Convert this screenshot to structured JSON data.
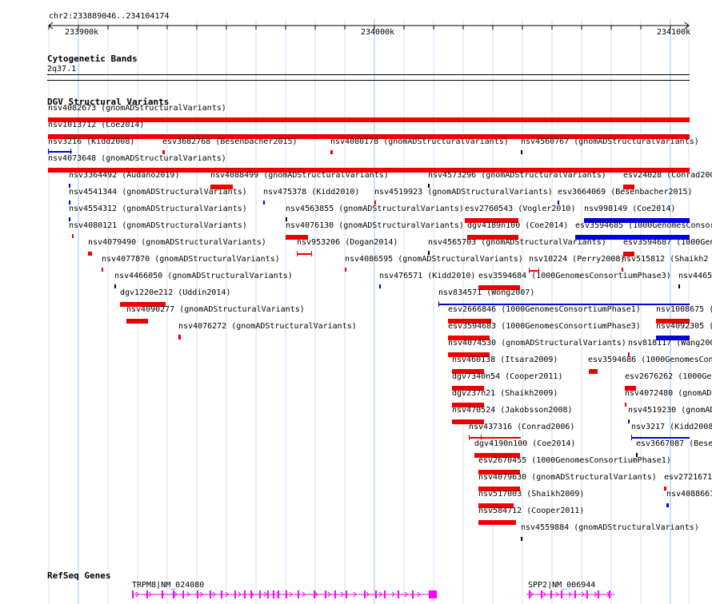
{
  "header": {
    "locus": "chr2:233889046..234104174"
  },
  "ruler": {
    "ticks": [
      "233900k",
      "234000k",
      "234100k"
    ]
  },
  "cytoband": {
    "title": "Cytogenetic Bands",
    "band": "2q37.1"
  },
  "dgv": {
    "title": "DGV Structural Variants",
    "features": [
      {
        "id": "nsv4082673 (gnomADStructuralVariants)",
        "color": "#ee0000"
      },
      {
        "id": "nsv1013712 (Coe2014)",
        "color": "#ee0000"
      },
      {
        "id": "nsv3216 (Kidd2008)",
        "color": "#0000dd"
      },
      {
        "id": "esv3682768 (Besenbacher2015)",
        "color": "#ee0000"
      },
      {
        "id": "nsv4080178 (gnomADStructuralVariants)",
        "color": "#ee0000"
      },
      {
        "id": "nsv4560767 (gnomADStructuralVariants)",
        "color": "#000000"
      },
      {
        "id": "nsv4073648 (gnomADStructuralVariants)",
        "color": "#ee0000"
      },
      {
        "id": "nsv3364492 (Audano2019)",
        "color": "#0000dd"
      },
      {
        "id": "nsv4088499 (gnomADStructuralVariants)",
        "color": "#ee0000"
      },
      {
        "id": "nsv4573296 (gnomADStructuralVariants)",
        "color": "#000000"
      },
      {
        "id": "esv24028 (Conrad200",
        "color": "#ee0000"
      },
      {
        "id": "nsv4541344 (gnomADStructuralVariants)",
        "color": "#0000dd"
      },
      {
        "id": "nsv475378 (Kidd2010)",
        "color": "#0000dd"
      },
      {
        "id": "nsv4519923 (gnomADStructuralVariants)",
        "color": "#ee0000"
      },
      {
        "id": "esv3664069 (Besenbacher2015)",
        "color": "#0000dd"
      },
      {
        "id": "nsv4554312 (gnomADStructuralVariants)",
        "color": "#0000dd"
      },
      {
        "id": "nsv4563855 (gnomADStructuralVariants)",
        "color": "#000000"
      },
      {
        "id": "esv2760543 (Vogler2010)",
        "color": "#ee0000"
      },
      {
        "id": "nsv998149 (Coe2014)",
        "color": "#0000dd"
      },
      {
        "id": "nsv4080121 (gnomADStructuralVariants)",
        "color": "#ee0000"
      },
      {
        "id": "nsv4076130 (gnomADStructuralVariants)",
        "color": "#ee0000"
      },
      {
        "id": "dgv4189n100 (Coe2014)",
        "color": "#ee0000"
      },
      {
        "id": "esv3594685 (1000GenomesConsor",
        "color": "#0000dd"
      },
      {
        "id": "nsv4079490 (gnomADStructuralVariants)",
        "color": "#ee0000"
      },
      {
        "id": "nsv953206 (Dogan2014)",
        "color": "#ee0000"
      },
      {
        "id": "nsv4565703 (gnomADStructuralVariants)",
        "color": "#000000"
      },
      {
        "id": "esv3594687 (1000Gen",
        "color": "#ee0000"
      },
      {
        "id": "nsv4077870 (gnomADStructuralVariants)",
        "color": "#ee0000"
      },
      {
        "id": "nsv4086595 (gnomADStructuralVariants)",
        "color": "#ee0000"
      },
      {
        "id": "nsv10224 (Perry2008)",
        "color": "#ee0000"
      },
      {
        "id": "nsv515812 (Shaikh2",
        "color": "#ee0000"
      },
      {
        "id": "nsv4466050 (gnomADStructuralVariants)",
        "color": "#000000"
      },
      {
        "id": "nsv476571 (Kidd2010)",
        "color": "#0000dd"
      },
      {
        "id": "esv3594684 (1000GenomesConsortiumPhase3)",
        "color": "#ee0000"
      },
      {
        "id": "nsv4465",
        "color": "#000000"
      },
      {
        "id": "dgv1220e212 (Uddin2014)",
        "color": "#ee0000"
      },
      {
        "id": "nsv834571 (Wong2007)",
        "color": "#0000dd"
      },
      {
        "id": "nsv4090277 (gnomADStructuralVariants)",
        "color": "#ee0000"
      },
      {
        "id": "esv2666846 (1000GenomesConsortiumPhase1)",
        "color": "#ee0000"
      },
      {
        "id": "nsv1008675 (Coe",
        "color": "#ee0000"
      },
      {
        "id": "nsv4076272 (gnomADStructuralVariants)",
        "color": "#ee0000"
      },
      {
        "id": "esv3594683 (1000GenomesConsortiumPhase3)",
        "color": "#ee0000"
      },
      {
        "id": "nsv4092305 (gno",
        "color": "#0000dd"
      },
      {
        "id": "nsv4074530 (gnomADStructuralVariants)",
        "color": "#ee0000"
      },
      {
        "id": "nsv818117 (Wang200",
        "color": "#ee0000"
      },
      {
        "id": "nsv460138 (Itsara2009)",
        "color": "#ee0000"
      },
      {
        "id": "esv3594686 (1000GenomesConsortiumPhase3)",
        "color": "#ee0000"
      },
      {
        "id": "dgv7340n54 (Cooper2011)",
        "color": "#ee0000"
      },
      {
        "id": "esv2676262 (1000Gen",
        "color": "#ee0000"
      },
      {
        "id": "dgv237n21 (Shaikh2009)",
        "color": "#ee0000"
      },
      {
        "id": "nsv4072480 (gnomAD",
        "color": "#ee0000"
      },
      {
        "id": "nsv470524 (Jakobsson2008)",
        "color": "#ee0000"
      },
      {
        "id": "nsv4519230 (gnomAD",
        "color": "#0000dd"
      },
      {
        "id": "nsv437316 (Conrad2006)",
        "color": "#ee0000"
      },
      {
        "id": "nsv3217 (Kidd2008",
        "color": "#0000dd"
      },
      {
        "id": "dgv4190n100 (Coe2014)",
        "color": "#ee0000"
      },
      {
        "id": "esv3667087 (Bese",
        "color": "#000000"
      },
      {
        "id": "esv2670455 (1000GenomesConsortiumPhase1)",
        "color": "#ee0000"
      },
      {
        "id": "nsv4079630 (gnomADStructuralVariants)",
        "color": "#ee0000"
      },
      {
        "id": "esv2721671",
        "color": "#ee0000"
      },
      {
        "id": "nsv517003 (Shaikh2009)",
        "color": "#ee0000"
      },
      {
        "id": "nsv4088661",
        "color": "#0000dd"
      },
      {
        "id": "nsv584712 (Cooper2011)",
        "color": "#ee0000"
      },
      {
        "id": "nsv4559884 (gnomADStructuralVariants)",
        "color": "#000000"
      }
    ]
  },
  "refseq": {
    "title": "RefSeq Genes",
    "genes": [
      {
        "name": "TRPM8|NM_024080",
        "color": "#ff00ff"
      },
      {
        "name": "SPP2|NM_006944",
        "color": "#ff00ff"
      }
    ]
  }
}
